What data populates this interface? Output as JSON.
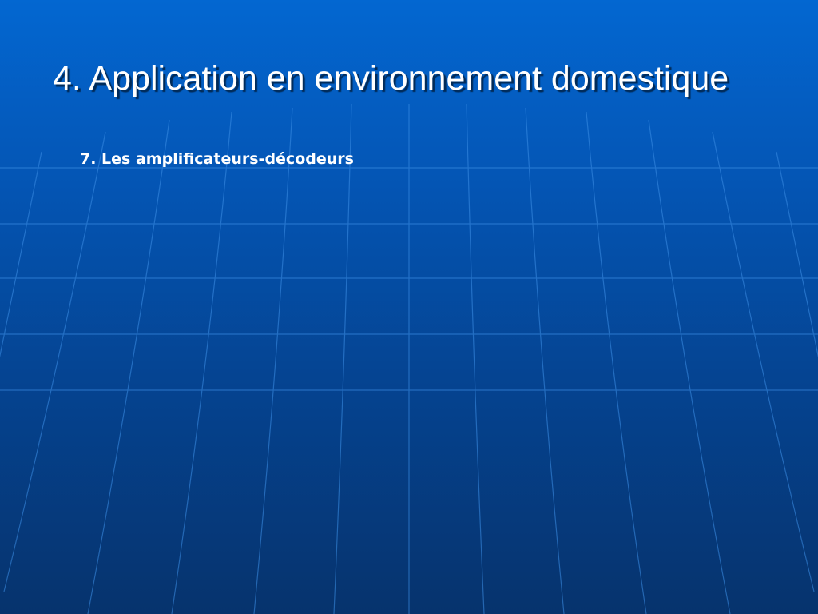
{
  "slide": {
    "title": "4. Application en environnement domestique",
    "subtitle": "7. Les amplificateurs-décodeurs"
  },
  "colors": {
    "background_top": "#0367d1",
    "background_bottom": "#06336d",
    "grid_lines": "#3d8fe6",
    "text": "#ffffff"
  }
}
